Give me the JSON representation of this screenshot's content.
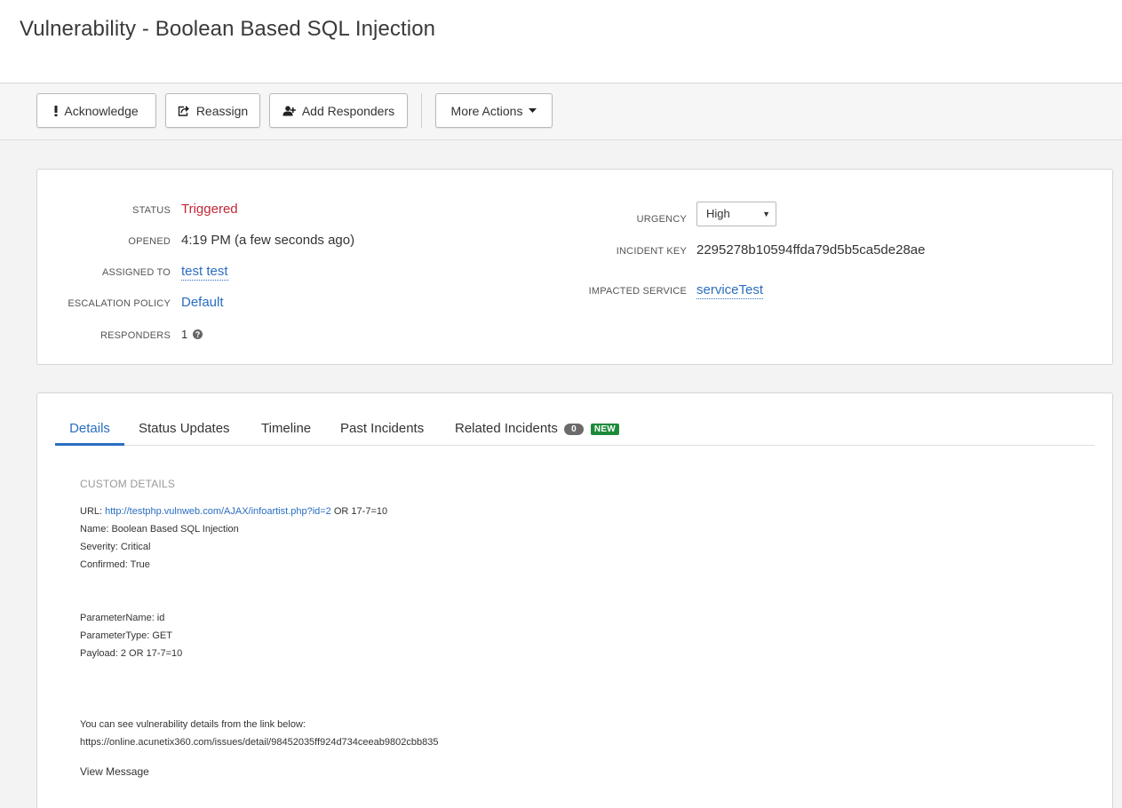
{
  "page": {
    "title": "Vulnerability - Boolean Based SQL Injection"
  },
  "toolbar": {
    "acknowledge": "Acknowledge",
    "reassign": "Reassign",
    "add_responders": "Add Responders",
    "more_actions": "More Actions"
  },
  "summary": {
    "status": {
      "label": "STATUS",
      "value": "Triggered",
      "color": "#c22837"
    },
    "opened": {
      "label": "OPENED",
      "value": "4:19 PM (a few seconds ago)"
    },
    "assigned_to": {
      "label": "ASSIGNED TO",
      "value": "test test"
    },
    "escalation_policy": {
      "label": "ESCALATION POLICY",
      "value": "Default"
    },
    "responders": {
      "label": "RESPONDERS",
      "value": "1"
    },
    "urgency": {
      "label": "URGENCY",
      "value": "High"
    },
    "incident_key": {
      "label": "INCIDENT KEY",
      "value": "2295278b10594ffda79d5b5ca5de28ae"
    },
    "impacted_service": {
      "label": "IMPACTED SERVICE",
      "value": "serviceTest"
    }
  },
  "tabs": {
    "details": "Details",
    "status_updates": "Status Updates",
    "timeline": "Timeline",
    "past_incidents": "Past Incidents",
    "related_incidents": "Related Incidents",
    "related_count": "0",
    "new_badge": "NEW"
  },
  "details": {
    "heading": "CUSTOM DETAILS",
    "url_label": "URL: ",
    "url_link": "http://testphp.vulnweb.com/AJAX/infoartist.php?id=2",
    "url_suffix": " OR 17-7=10",
    "name": "Name: Boolean Based SQL Injection",
    "severity": "Severity: Critical",
    "confirmed": "Confirmed: True",
    "parameter_name": "ParameterName: id",
    "parameter_type": "ParameterType: GET",
    "payload": "Payload: 2 OR 17-7=10",
    "see_details": "You can see vulnerability details from the link below:",
    "details_link": "https://online.acunetix360.com/issues/detail/98452035ff924d734ceeab9802cbb835",
    "view_message": "View Message"
  },
  "colors": {
    "link": "#2a6ec1",
    "triggered": "#c22837",
    "new_badge": "#1d8a3a"
  }
}
